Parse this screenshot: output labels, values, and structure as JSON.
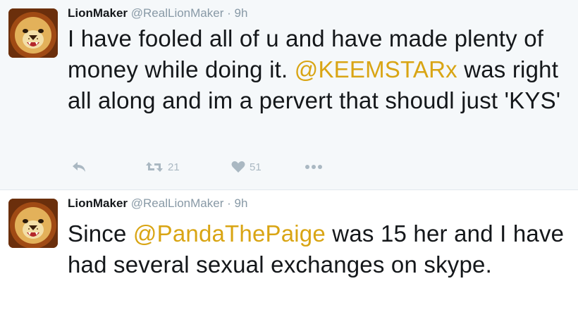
{
  "tweets": [
    {
      "name": "LionMaker",
      "handle": "@RealLionMaker",
      "separator": "·",
      "time": "9h",
      "text_parts": [
        {
          "t": "I have fooled all of u and have made plenty of money while doing it. "
        },
        {
          "t": "@KEEMSTARx",
          "mention": true
        },
        {
          "t": " was right all along and im a pervert that shoudl just 'KYS'"
        }
      ],
      "retweets": "21",
      "likes": "51"
    },
    {
      "name": "LionMaker",
      "handle": "@RealLionMaker",
      "separator": "·",
      "time": "9h",
      "text_parts": [
        {
          "t": "Since "
        },
        {
          "t": "@PandaThePaige",
          "mention": true
        },
        {
          "t": " was 15 her and I have had several sexual exchanges on skype."
        }
      ]
    }
  ],
  "icons": {
    "avatar": "lion-avatar-icon",
    "reply": "reply-icon",
    "retweet": "retweet-icon",
    "like": "heart-icon",
    "more": "more-dots-icon"
  },
  "colors": {
    "mention": "#d9a514",
    "muted": "#8899a6",
    "action": "#aab8c2",
    "tweet1_bg": "#f5f8fa"
  }
}
